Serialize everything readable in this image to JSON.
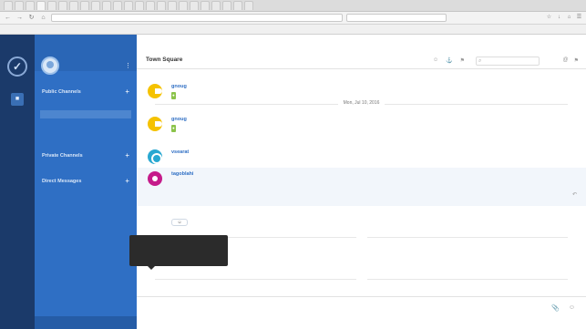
{
  "browser": {
    "tabs": [
      "",
      "",
      "",
      "",
      "",
      "",
      "",
      "",
      "",
      "",
      "",
      "",
      "",
      "",
      "",
      "",
      "",
      "",
      "",
      "",
      "",
      "",
      ""
    ],
    "url": "",
    "search_placeholder": "",
    "bookmarks": [
      "",
      "",
      "",
      "",
      "",
      "",
      "",
      "",
      "",
      ""
    ]
  },
  "sidebar": {
    "user_name": "",
    "user_status": "",
    "section_public": "Public Channels",
    "public_channels": [
      "",
      ""
    ],
    "public_more": "",
    "section_private": "Private Channels",
    "section_direct": "Direct Messages",
    "direct_messages": [
      "",
      "",
      "",
      "",
      ""
    ],
    "direct_more": "",
    "footer": ""
  },
  "channel": {
    "title": "Town Square",
    "description": ""
  },
  "messages": [
    {
      "author": "gnoug",
      "time": "",
      "text": "",
      "link": ""
    },
    {
      "date": "Mon, Jul 10, 2016"
    },
    {
      "author": "gnoug",
      "time": "",
      "text": "",
      "link": ""
    },
    {
      "author": "vsearat",
      "time": "",
      "text": "",
      "link": ""
    },
    {
      "author": "tagoblahi",
      "time": "",
      "text": "",
      "link": ""
    },
    {
      "author": "",
      "time": "",
      "text": "",
      "link": ""
    },
    {
      "date": ""
    },
    {
      "author": "gnoug",
      "time": "",
      "text": "",
      "link": ""
    },
    {
      "date": ""
    }
  ],
  "tooltip": {
    "line1": "",
    "line2": "",
    "line3": ""
  },
  "composer": {
    "placeholder": ""
  },
  "colors": {
    "sidebar": "#2f6fc4",
    "team_rail": "#1b3a6a",
    "link": "#2f6fc4",
    "avatar_yellow": "#f5c200",
    "avatar_teal": "#29a8d1",
    "avatar_pink": "#c51b8a"
  },
  "icons": [
    "back-icon",
    "forward-icon",
    "reload-icon",
    "home-icon",
    "menu-icon",
    "search-icon",
    "attach-icon",
    "emoji-icon",
    "reply-icon",
    "team-logo-icon"
  ]
}
